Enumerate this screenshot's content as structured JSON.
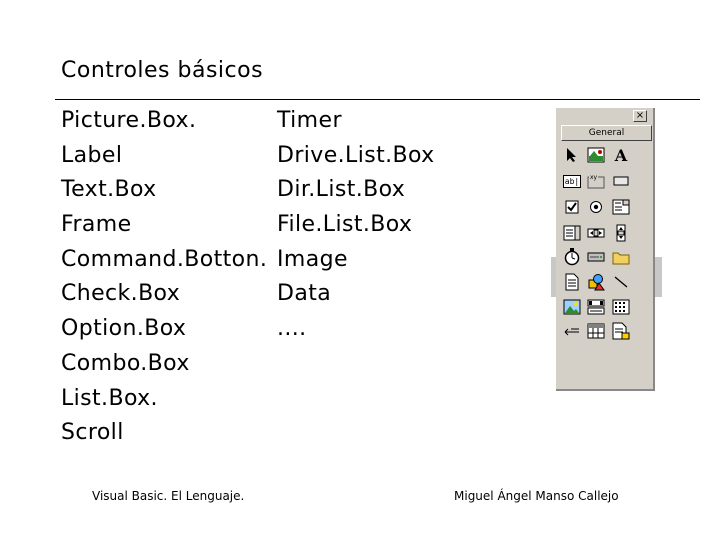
{
  "slide": {
    "title": "Controles básicos",
    "left_items": [
      "Picture.Box.",
      "Label",
      "Text.Box",
      "Frame",
      "Command.Botton.",
      "Check.Box",
      "Option.Box",
      "Combo.Box",
      "List.Box.",
      "Scroll"
    ],
    "right_items": [
      "Timer",
      "Drive.List.Box",
      "Dir.List.Box",
      "File.List.Box",
      "Image",
      "Data",
      "...."
    ]
  },
  "toolbox": {
    "close_label": "×",
    "tab_label": "General",
    "tools": [
      {
        "icon": "pointer-icon"
      },
      {
        "icon": "picturebox-icon"
      },
      {
        "icon": "label-icon",
        "text": "A"
      },
      {
        "icon": "textbox-icon",
        "text": "ab|"
      },
      {
        "icon": "frame-icon",
        "text": "xy"
      },
      {
        "icon": "commandbutton-icon"
      },
      {
        "icon": "checkbox-icon"
      },
      {
        "icon": "optionbutton-icon"
      },
      {
        "icon": "combobox-icon"
      },
      {
        "icon": "listbox-icon"
      },
      {
        "icon": "hscrollbar-icon"
      },
      {
        "icon": "vscrollbar-icon"
      },
      {
        "icon": "timer-icon"
      },
      {
        "icon": "drivelistbox-icon"
      },
      {
        "icon": "dirlistbox-icon"
      },
      {
        "icon": "filelistbox-icon"
      },
      {
        "icon": "shape-icon"
      },
      {
        "icon": "line-icon"
      },
      {
        "icon": "image-icon"
      },
      {
        "icon": "data-icon"
      },
      {
        "icon": "ole-icon"
      },
      {
        "icon": "grid-icon"
      },
      {
        "icon": "dbgrid-icon"
      },
      {
        "icon": "dblist-icon"
      }
    ]
  },
  "footer": {
    "left": "Visual Basic. El Lenguaje.",
    "right": "Miguel Ángel Manso Callejo"
  }
}
